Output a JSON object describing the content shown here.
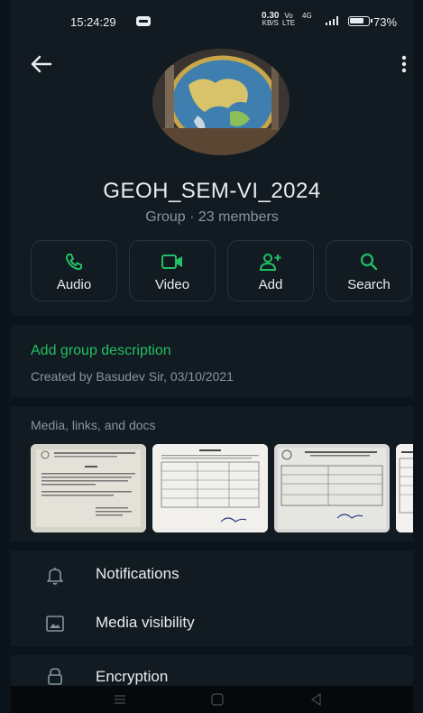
{
  "status_bar": {
    "time": "15:24:29",
    "net_speed_value": "0.30",
    "net_speed_unit": "KB/S",
    "volte_top": "Vo",
    "volte_bottom": "LTE",
    "network_type": "4G",
    "battery_percent": "73%"
  },
  "group": {
    "name": "GEOH_SEM-VI_2024",
    "subtitle": "Group · 23 members"
  },
  "actions": [
    {
      "label": "Audio",
      "icon": "phone-icon"
    },
    {
      "label": "Video",
      "icon": "video-icon"
    },
    {
      "label": "Add",
      "icon": "add-person-icon"
    },
    {
      "label": "Search",
      "icon": "search-icon"
    }
  ],
  "description": {
    "link": "Add group description",
    "created": "Created by Basudev Sir, 03/10/2021"
  },
  "media": {
    "header": "Media, links, and docs",
    "thumbnails": [
      "document-thumbnail-1",
      "document-thumbnail-2",
      "document-thumbnail-3",
      "document-thumbnail-4"
    ]
  },
  "settings": [
    {
      "label": "Notifications",
      "icon": "bell-icon"
    },
    {
      "label": "Media visibility",
      "icon": "image-icon"
    },
    {
      "label": "Encryption",
      "icon": "lock-icon"
    }
  ],
  "colors": {
    "background": "#111b21",
    "accent_green": "#21c063",
    "secondary_text": "#8696a0"
  }
}
